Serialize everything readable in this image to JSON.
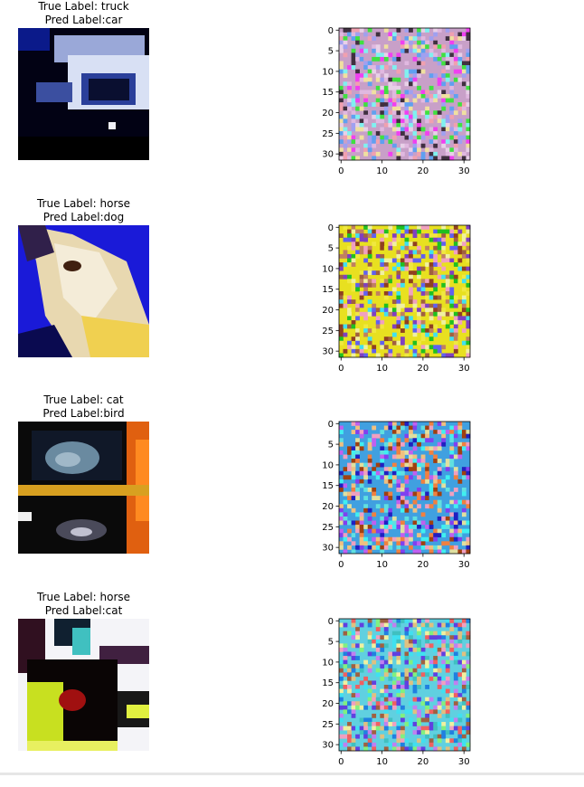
{
  "chart_data": [
    {
      "type": "image",
      "title_line1": "True Label: truck",
      "title_line2": "Pred Label:car",
      "xticks": [
        0,
        10,
        20,
        30
      ],
      "yticks": [
        0,
        5,
        10,
        15,
        20,
        25,
        30
      ],
      "xlim": [
        -0.5,
        31.5
      ],
      "ylim": [
        31.5,
        -0.5
      ]
    },
    {
      "type": "image",
      "title_line1": "True Label: horse",
      "title_line2": "Pred Label:dog",
      "xticks": [
        0,
        10,
        20,
        30
      ],
      "yticks": [
        0,
        5,
        10,
        15,
        20,
        25,
        30
      ],
      "xlim": [
        -0.5,
        31.5
      ],
      "ylim": [
        31.5,
        -0.5
      ]
    },
    {
      "type": "image",
      "title_line1": "True Label: cat",
      "title_line2": "Pred Label:bird",
      "xticks": [
        0,
        10,
        20,
        30
      ],
      "yticks": [
        0,
        5,
        10,
        15,
        20,
        25,
        30
      ],
      "xlim": [
        -0.5,
        31.5
      ],
      "ylim": [
        31.5,
        -0.5
      ]
    },
    {
      "type": "image",
      "title_line1": "True Label: horse",
      "title_line2": "Pred Label:cat",
      "xticks": [
        0,
        10,
        20,
        30
      ],
      "yticks": [
        0,
        5,
        10,
        15,
        20,
        25,
        30
      ],
      "xlim": [
        -0.5,
        31.5
      ],
      "ylim": [
        31.5,
        -0.5
      ]
    }
  ]
}
